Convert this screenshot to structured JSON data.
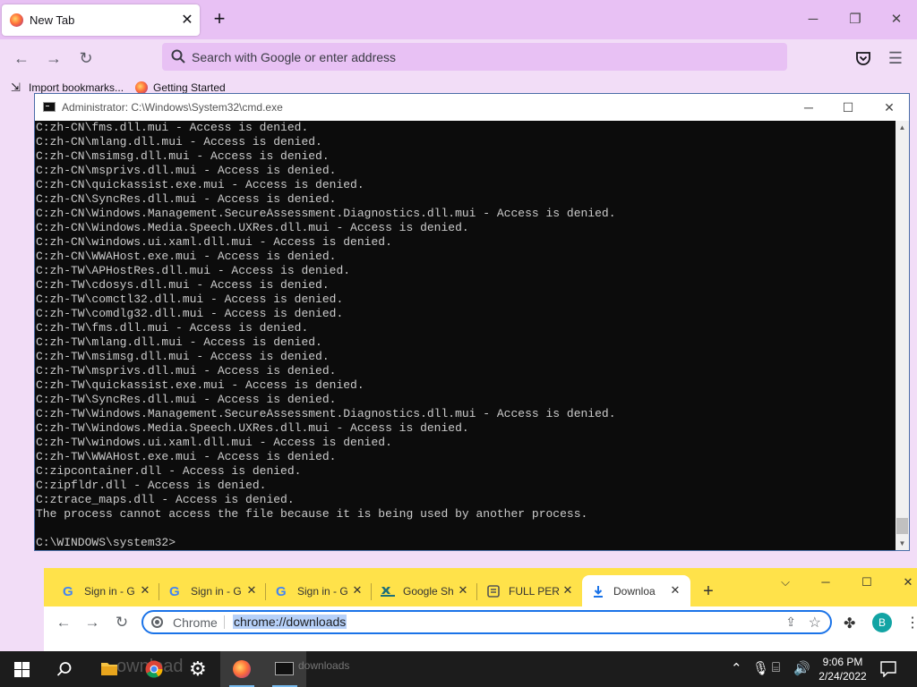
{
  "firefox": {
    "tab_title": "New Tab",
    "url_placeholder": "Search with Google or enter address",
    "bookmarks": [
      "Import bookmarks...",
      "Getting Started"
    ]
  },
  "cmd": {
    "title": "Administrator: C:\\Windows\\System32\\cmd.exe",
    "lines": [
      "C:zh-CN\\fms.dll.mui - Access is denied.",
      "C:zh-CN\\mlang.dll.mui - Access is denied.",
      "C:zh-CN\\msimsg.dll.mui - Access is denied.",
      "C:zh-CN\\msprivs.dll.mui - Access is denied.",
      "C:zh-CN\\quickassist.exe.mui - Access is denied.",
      "C:zh-CN\\SyncRes.dll.mui - Access is denied.",
      "C:zh-CN\\Windows.Management.SecureAssessment.Diagnostics.dll.mui - Access is denied.",
      "C:zh-CN\\Windows.Media.Speech.UXRes.dll.mui - Access is denied.",
      "C:zh-CN\\windows.ui.xaml.dll.mui - Access is denied.",
      "C:zh-CN\\WWAHost.exe.mui - Access is denied.",
      "C:zh-TW\\APHostRes.dll.mui - Access is denied.",
      "C:zh-TW\\cdosys.dll.mui - Access is denied.",
      "C:zh-TW\\comctl32.dll.mui - Access is denied.",
      "C:zh-TW\\comdlg32.dll.mui - Access is denied.",
      "C:zh-TW\\fms.dll.mui - Access is denied.",
      "C:zh-TW\\mlang.dll.mui - Access is denied.",
      "C:zh-TW\\msimsg.dll.mui - Access is denied.",
      "C:zh-TW\\msprivs.dll.mui - Access is denied.",
      "C:zh-TW\\quickassist.exe.mui - Access is denied.",
      "C:zh-TW\\SyncRes.dll.mui - Access is denied.",
      "C:zh-TW\\Windows.Management.SecureAssessment.Diagnostics.dll.mui - Access is denied.",
      "C:zh-TW\\Windows.Media.Speech.UXRes.dll.mui - Access is denied.",
      "C:zh-TW\\windows.ui.xaml.dll.mui - Access is denied.",
      "C:zh-TW\\WWAHost.exe.mui - Access is denied.",
      "C:zipcontainer.dll - Access is denied.",
      "C:zipfldr.dll - Access is denied.",
      "C:ztrace_maps.dll - Access is denied.",
      "The process cannot access the file because it is being used by another process.",
      "",
      "C:\\WINDOWS\\system32>"
    ]
  },
  "chrome": {
    "tabs": [
      {
        "title": "Sign in - G",
        "icon": "google-icon"
      },
      {
        "title": "Sign in - G",
        "icon": "google-icon"
      },
      {
        "title": "Sign in - G",
        "icon": "google-icon"
      },
      {
        "title": "Google Sh",
        "icon": "sheets-icon"
      },
      {
        "title": "FULL PERI",
        "icon": "page-icon"
      },
      {
        "title": "Downloa",
        "icon": "download-icon"
      }
    ],
    "omnibox_chip": "Chrome",
    "url": "chrome://downloads",
    "avatar_letter": "B"
  },
  "taskbar": {
    "ghost_text": "ownload",
    "ghost_text2": "downloads",
    "time": "9:06 PM",
    "date": "2/24/2022"
  },
  "colors": {
    "firefox_chrome": "#e8c1f4",
    "firefox_toolbar": "#f2ddf7",
    "cmd_bg": "#0c0c0c",
    "cmd_text": "#cccccc",
    "chrome_frame": "#ffe24a",
    "chrome_focus": "#1a73e8",
    "taskbar": "#1c1c1c"
  }
}
